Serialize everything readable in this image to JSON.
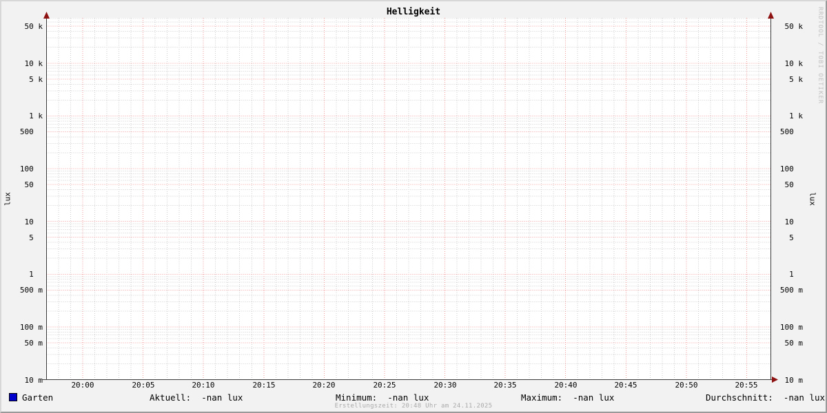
{
  "title": "Helligkeit",
  "watermark": "RRDTOOL / TOBI OETIKER",
  "footer": "Erstellungszeit: 20:48 Uhr am 24.11.2025",
  "colors": {
    "background": "#f2f2f2",
    "canvas": "#ffffff",
    "minor_grid": "#cccccc",
    "major_grid": "#f19999",
    "axis": "#3a3a3a",
    "arrow": "#8e1212",
    "series_garten": "#0000cc",
    "footer_text": "#a9a9a9",
    "watermark_text": "#c2c2c2"
  },
  "y_axis": {
    "unit_label": "lux",
    "scale": "logarithmic",
    "ticks": [
      {
        "label": "50 k",
        "value": 50000
      },
      {
        "label": "10 k",
        "value": 10000
      },
      {
        "label": "5 k",
        "value": 5000
      },
      {
        "label": "1 k",
        "value": 1000
      },
      {
        "label": "500",
        "value": 500
      },
      {
        "label": "100",
        "value": 100
      },
      {
        "label": "50",
        "value": 50
      },
      {
        "label": "10",
        "value": 10
      },
      {
        "label": "5",
        "value": 5
      },
      {
        "label": "1",
        "value": 1
      },
      {
        "label": "500 m",
        "value": 0.5
      },
      {
        "label": "100 m",
        "value": 0.1
      },
      {
        "label": "50 m",
        "value": 0.05
      },
      {
        "label": "10 m",
        "value": 0.01
      }
    ]
  },
  "x_axis": {
    "ticks": [
      "20:00",
      "20:05",
      "20:10",
      "20:15",
      "20:20",
      "20:25",
      "20:30",
      "20:35",
      "20:40",
      "20:45",
      "20:50",
      "20:55"
    ],
    "minor_step_minutes": 1,
    "major_step_minutes": 5
  },
  "legend": {
    "series": [
      {
        "label": "Garten",
        "color": "#0000cc"
      }
    ],
    "stats": [
      {
        "label": "Aktuell:",
        "value": "-nan lux"
      },
      {
        "label": "Minimum:",
        "value": "-nan lux"
      },
      {
        "label": "Maximum:",
        "value": "-nan lux"
      },
      {
        "label": "Durchschnitt:",
        "value": "-nan lux"
      }
    ]
  },
  "chart_data": {
    "type": "line",
    "title": "Helligkeit",
    "xlabel": "",
    "ylabel": "lux",
    "y_scale": "log",
    "ylim": [
      0.01,
      80000
    ],
    "x_range": [
      "19:57",
      "20:57"
    ],
    "x_tick_labels": [
      "20:00",
      "20:05",
      "20:10",
      "20:15",
      "20:20",
      "20:25",
      "20:30",
      "20:35",
      "20:40",
      "20:45",
      "20:50",
      "20:55"
    ],
    "y_tick_labels": [
      "50 k",
      "10 k",
      "5 k",
      "1 k",
      "500",
      "100",
      "50",
      "10",
      "5",
      "1",
      "500 m",
      "100 m",
      "50 m",
      "10 m"
    ],
    "grid": true,
    "legend_position": "bottom",
    "series": [
      {
        "name": "Garten",
        "color": "#0000cc",
        "x": [],
        "values": [],
        "note": "no data plotted; all values NaN"
      }
    ],
    "stats": {
      "Aktuell": "-nan lux",
      "Minimum": "-nan lux",
      "Maximum": "-nan lux",
      "Durchschnitt": "-nan lux"
    },
    "annotations": [
      "Erstellungszeit: 20:48 Uhr am 24.11.2025",
      "RRDTOOL / TOBI OETIKER"
    ]
  }
}
